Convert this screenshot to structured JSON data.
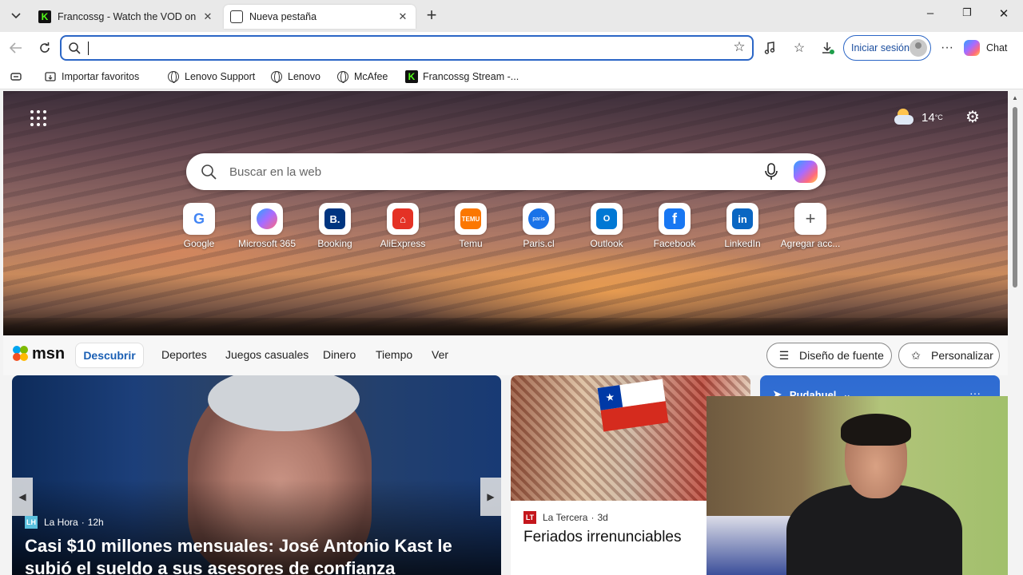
{
  "tabs": [
    {
      "title": "Francossg - Watch the VOD on Kick",
      "icon": "kick-favicon"
    },
    {
      "title": "Nueva pestaña",
      "icon": "newtab-favicon",
      "active": true
    }
  ],
  "address_bar": {
    "value": "",
    "placeholder": ""
  },
  "toolbar": {
    "signin_label": "Iniciar sesión",
    "chat_label": "Chat",
    "more": "···"
  },
  "favorites": [
    {
      "label": "Importar favoritos",
      "icon": "import-icon"
    },
    {
      "label": "Lenovo Support",
      "icon": "globe-icon"
    },
    {
      "label": "Lenovo",
      "icon": "globe-icon"
    },
    {
      "label": "McAfee",
      "icon": "globe-icon"
    },
    {
      "label": "Francossg Stream -...",
      "icon": "kick-favicon"
    }
  ],
  "weather": {
    "temp": "14",
    "unit": "°C",
    "icon": "partly-cloudy-icon"
  },
  "web_search": {
    "placeholder": "Buscar en la web"
  },
  "quick_links": [
    {
      "label": "Google",
      "badge": "G",
      "color": "#4285F4"
    },
    {
      "label": "Microsoft 365",
      "badge": "M",
      "color": "#7b61ff"
    },
    {
      "label": "Booking",
      "badge": "B.",
      "color": "#003580"
    },
    {
      "label": "AliExpress",
      "badge": "A",
      "color": "#e43225"
    },
    {
      "label": "Temu",
      "badge": "TEMU",
      "color": "#fb7701"
    },
    {
      "label": "Paris.cl",
      "badge": "paris",
      "color": "#1a73e8"
    },
    {
      "label": "Outlook",
      "badge": "O",
      "color": "#0078d4"
    },
    {
      "label": "Facebook",
      "badge": "f",
      "color": "#1877f2"
    },
    {
      "label": "LinkedIn",
      "badge": "in",
      "color": "#0a66c2"
    },
    {
      "label": "Agregar acc...",
      "badge": "+",
      "color": "#ffffff"
    }
  ],
  "msn": {
    "logo": "msn",
    "nav": [
      "Descubrir",
      "Deportes",
      "Juegos casuales",
      "Dinero",
      "Tiempo",
      "Ver"
    ],
    "font_design_label": "Diseño de fuente",
    "personalize_label": "Personalizar"
  },
  "feed": {
    "main": {
      "source": "La Hora",
      "age": "12h",
      "source_badge": "LH",
      "headline": "Casi $10 millones mensuales: José Antonio Kast le subió el sueldo a sus asesores de confianza"
    },
    "second": {
      "source": "La Tercera",
      "age": "3d",
      "source_badge": "LT",
      "headline": "Feriados irrenunciables"
    },
    "weather_card": {
      "location": "Pudahuel"
    }
  }
}
